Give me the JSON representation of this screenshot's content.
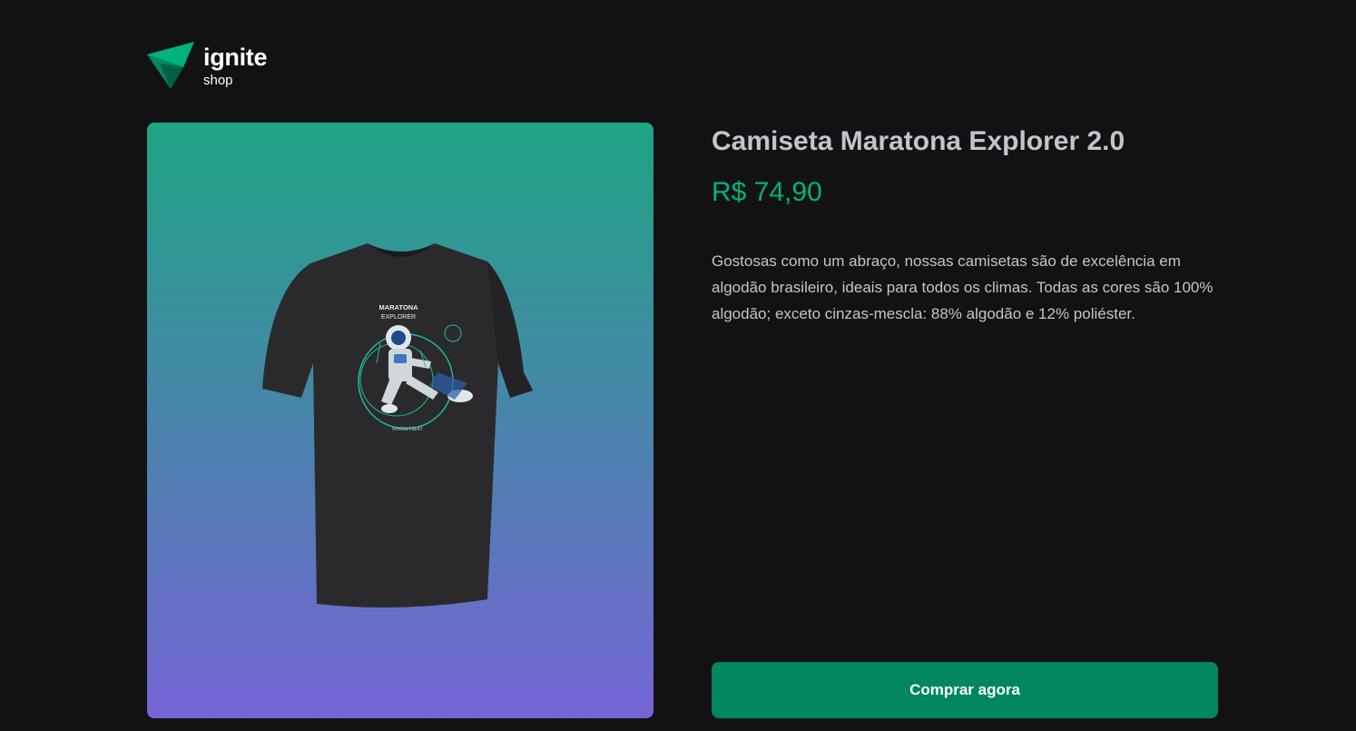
{
  "brand": {
    "title": "ignite",
    "subtitle": "shop"
  },
  "product": {
    "image_alt": "Camiseta Maratona Explorer 2.0",
    "print_title": "MARATONA",
    "print_subtitle": "EXPLORER",
    "print_brand": "ROCKETSEAT",
    "name": "Camiseta Maratona Explorer 2.0",
    "price": "R$ 74,90",
    "description": "Gostosas como um abraço, nossas camisetas são de excelência em algodão brasileiro, ideais para todos os climas. Todas as cores são 100% algodão; exceto cinzas-mescla: 88% algodão e 12% poliéster.",
    "buy_label": "Comprar agora"
  },
  "colors": {
    "background": "#121214",
    "brand_green": "#00875f",
    "price_green": "#00b37e",
    "gradient_top": "#1ea483",
    "gradient_bottom": "#7465d4"
  }
}
